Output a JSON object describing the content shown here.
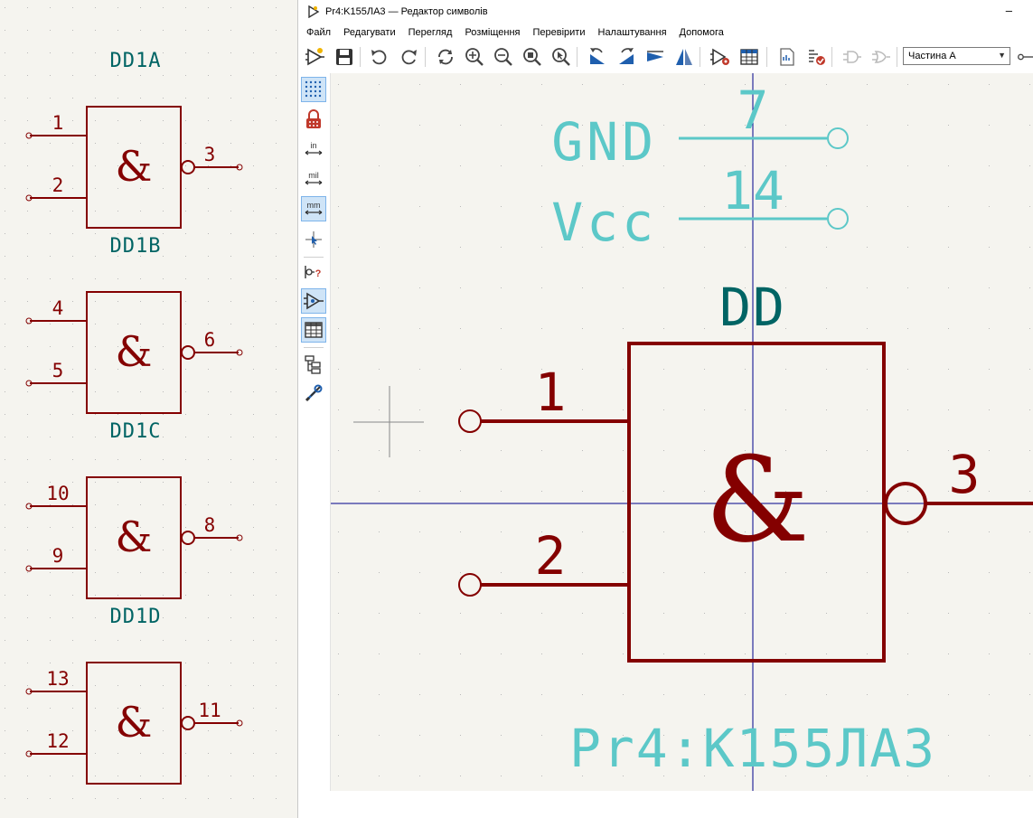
{
  "window": {
    "title": "Pr4:K155ЛА3 — Редактор символів",
    "minimize_glyph": "–"
  },
  "menu": [
    "Файл",
    "Редагувати",
    "Перегляд",
    "Розміщення",
    "Перевірити",
    "Налаштування",
    "Допомога"
  ],
  "toolbar": {
    "unit_select": {
      "selected": "Частина A"
    },
    "buttons": [
      "new-symbol-icon",
      "save-icon",
      "undo-icon",
      "redo-icon",
      "refresh-icon",
      "zoom-in-icon",
      "zoom-out-icon",
      "zoom-fit-icon",
      "zoom-selection-icon",
      "rotate-ccw-icon",
      "rotate-cw-icon",
      "mirror-horizontal-icon",
      "mirror-vertical-icon",
      "symbol-properties-icon",
      "pin-table-icon",
      "datasheet-icon",
      "check-symbol-icon",
      "de-morgan-standard-icon",
      "de-morgan-alternate-icon"
    ]
  },
  "left_toolbar": [
    {
      "icon": "grid-icon",
      "active": true
    },
    {
      "icon": "lock-icon",
      "active": false
    },
    {
      "icon": "units-inches-icon",
      "label": "in",
      "active": false
    },
    {
      "icon": "units-mils-icon",
      "label": "mil",
      "active": false
    },
    {
      "icon": "units-mm-icon",
      "label": "mm",
      "active": true
    },
    {
      "icon": "cursor-crosshair-icon",
      "active": false
    },
    {
      "icon": "show-pin-electrical-type-icon",
      "label": "?",
      "active": false
    },
    {
      "icon": "symbol-browser-icon",
      "active": true
    },
    {
      "icon": "pin-table-side-icon",
      "active": true
    },
    {
      "icon": "hierarchy-icon",
      "active": false
    },
    {
      "icon": "tools-icon",
      "active": false
    }
  ],
  "colors": {
    "body_outline": "#840000",
    "pin": "#840000",
    "reference": "#006464",
    "power_pin": "#5cc8c8",
    "crosshair": "#00008b",
    "background": "#f5f4ef"
  },
  "symbol": {
    "reference": "DD",
    "value": "Pr4:K155ЛА3",
    "gate_symbol": "&",
    "pins": [
      {
        "number": "1",
        "side": "left",
        "type": "input"
      },
      {
        "number": "2",
        "side": "left",
        "type": "input"
      },
      {
        "number": "3",
        "side": "right",
        "type": "output-inverted"
      }
    ],
    "power_pins": [
      {
        "name": "GND",
        "number": "7"
      },
      {
        "name": "Vcc",
        "number": "14"
      }
    ]
  },
  "schematic_preview": {
    "units": [
      {
        "label_above": "DD1A",
        "pins_in": [
          "1",
          "2"
        ],
        "pin_out": "3"
      },
      {
        "label_above": "DD1B",
        "pins_in": [
          "4",
          "5"
        ],
        "pin_out": "6"
      },
      {
        "label_above": "DD1C",
        "pins_in": [
          "10",
          "9"
        ],
        "pin_out": "8"
      },
      {
        "label_above": "DD1D",
        "pins_in": [
          "13",
          "12"
        ],
        "pin_out": "11"
      }
    ],
    "gate_symbol": "&"
  }
}
